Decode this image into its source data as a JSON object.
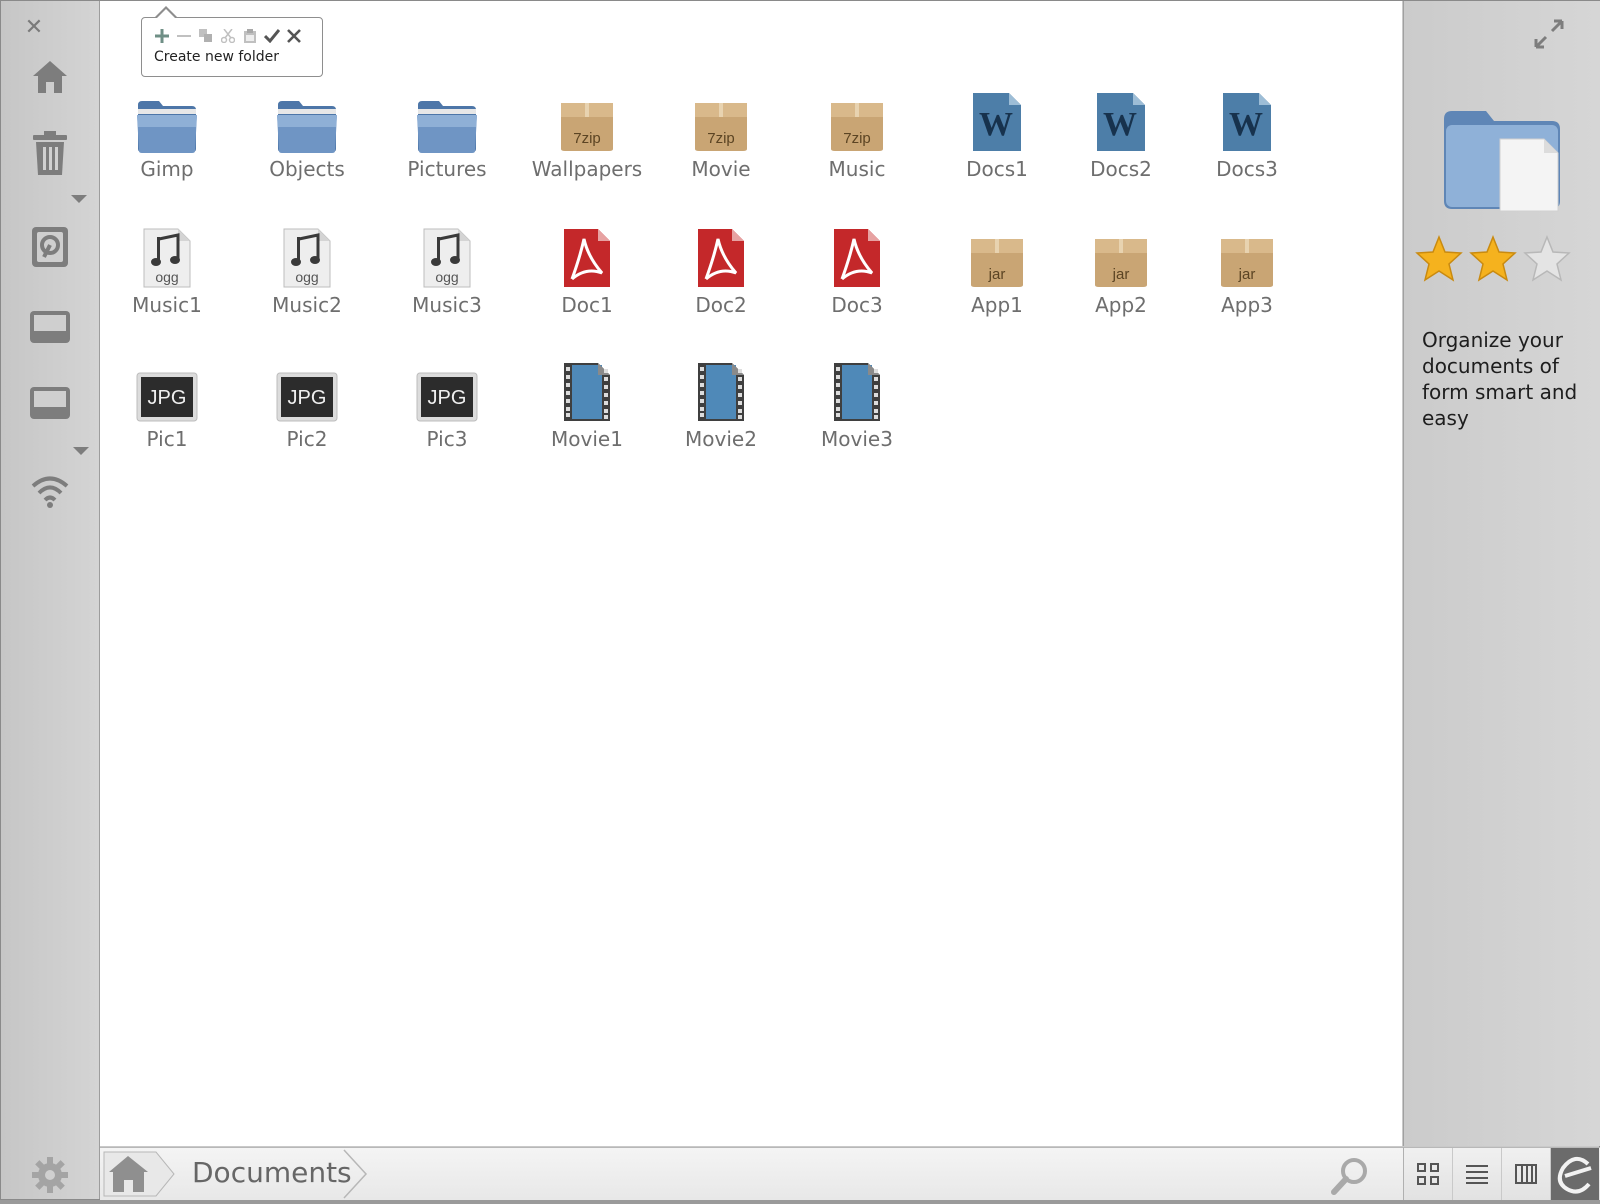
{
  "tooltip": {
    "text": "Create new folder",
    "tools": [
      "add-icon",
      "remove-icon",
      "copy-icon",
      "cut-icon",
      "paste-icon",
      "confirm-icon",
      "cancel-icon"
    ]
  },
  "sidebar": {
    "items": [
      "home-icon",
      "trash-icon",
      "drive-icon",
      "removable-drive-icon",
      "removable-drive-icon",
      "wifi-icon"
    ],
    "settings": "gear-icon"
  },
  "files": [
    {
      "name": "Gimp",
      "type": "folder"
    },
    {
      "name": "Objects",
      "type": "folder"
    },
    {
      "name": "Pictures",
      "type": "folder"
    },
    {
      "name": "Wallpapers",
      "type": "7zip"
    },
    {
      "name": "Movie",
      "type": "7zip"
    },
    {
      "name": "Music",
      "type": "7zip"
    },
    {
      "name": "Docs1",
      "type": "word"
    },
    {
      "name": "Docs2",
      "type": "word"
    },
    {
      "name": "Docs3",
      "type": "word"
    },
    {
      "name": "Music1",
      "type": "ogg"
    },
    {
      "name": "Music2",
      "type": "ogg"
    },
    {
      "name": "Music3",
      "type": "ogg"
    },
    {
      "name": "Doc1",
      "type": "pdf"
    },
    {
      "name": "Doc2",
      "type": "pdf"
    },
    {
      "name": "Doc3",
      "type": "pdf"
    },
    {
      "name": "App1",
      "type": "jar"
    },
    {
      "name": "App2",
      "type": "jar"
    },
    {
      "name": "App3",
      "type": "jar"
    },
    {
      "name": "Pic1",
      "type": "jpg"
    },
    {
      "name": "Pic2",
      "type": "jpg"
    },
    {
      "name": "Pic3",
      "type": "jpg"
    },
    {
      "name": "Movie1",
      "type": "movie"
    },
    {
      "name": "Movie2",
      "type": "movie"
    },
    {
      "name": "Movie3",
      "type": "movie"
    }
  ],
  "icon_text": {
    "zip": "7zip",
    "ogg": "ogg",
    "jar": "jar",
    "jpg": "JPG",
    "word": "W"
  },
  "right_panel": {
    "description": "Organize your documents of form smart and easy",
    "rating": 2,
    "rating_max": 3
  },
  "breadcrumb": {
    "current": "Documents"
  },
  "view_buttons": [
    "grid-view-icon",
    "list-view-icon",
    "columns-view-icon",
    "app-logo-icon"
  ],
  "colors": {
    "folder": "#6f95c4",
    "box": "#c9a574",
    "word": "#4d7ea8",
    "pdf": "#c4282a",
    "star": "#f5b21e"
  }
}
